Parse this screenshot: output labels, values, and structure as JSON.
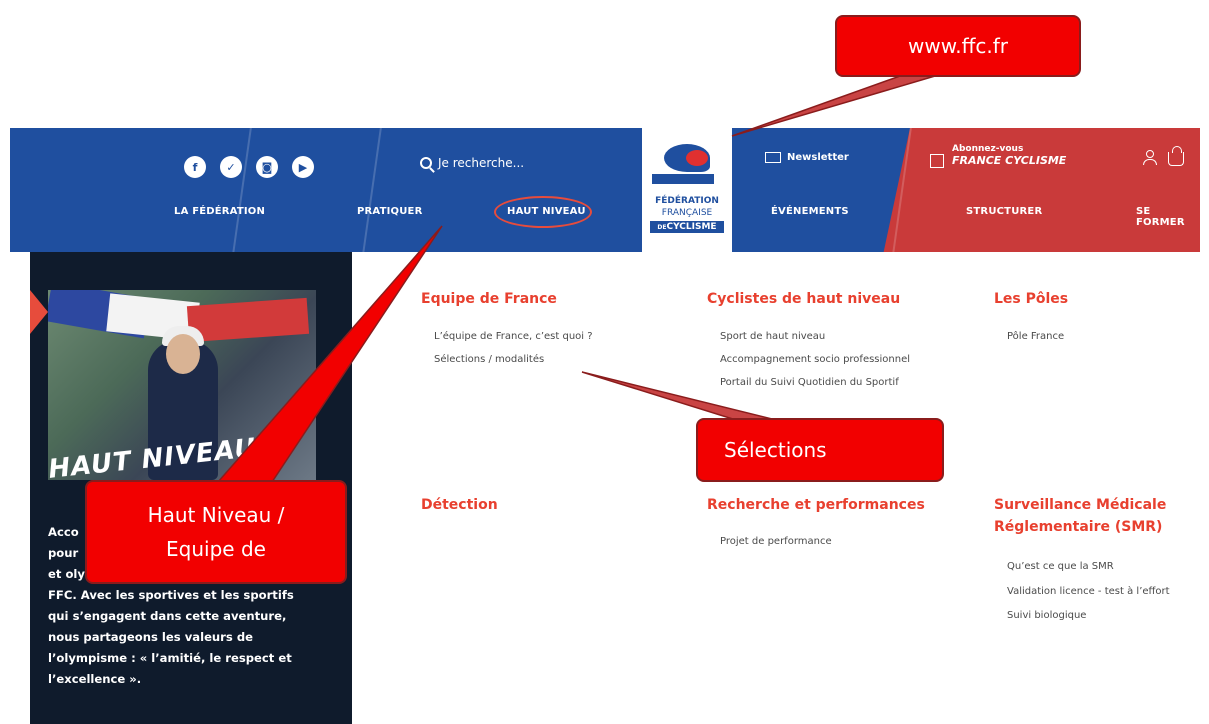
{
  "header": {
    "social": [
      {
        "icon": "facebook-icon",
        "glyph": "f"
      },
      {
        "icon": "twitter-icon",
        "glyph": "✓"
      },
      {
        "icon": "instagram-icon",
        "glyph": "◙"
      },
      {
        "icon": "youtube-icon",
        "glyph": "▶"
      }
    ],
    "search_placeholder": "Je recherche...",
    "nav": [
      "LA FÉDÉRATION",
      "PRATIQUER",
      "HAUT NIVEAU",
      "ÉVÉNEMENTS",
      "STRUCTURER",
      "SE FORMER"
    ],
    "logo": {
      "line1": "FÉDÉRATION",
      "line2": "FRANÇAISE",
      "line3": "CYCLISME",
      "line3_prefix": "DE"
    },
    "newsletter": "Newsletter",
    "abonnez": {
      "line1": "Abonnez-vous",
      "line2": "FRANCE CYCLISME"
    }
  },
  "sidebar": {
    "title": "HAUT NIVEAU",
    "body_visible_start": "Acco",
    "body_line2": "pour",
    "body_line3": "et oly",
    "body_line4": "FFC. Avec les sportives et les sportifs",
    "body_line5": "qui s’engagent dans cette aventure,",
    "body_line6": "nous partageons les valeurs de",
    "body_line7": "l’olympisme : « l’amitié, le respect et",
    "body_line8": "l’excellence »."
  },
  "menu": {
    "col1": {
      "title": "Equipe de France",
      "links": [
        "L’équipe de France, c’est quoi ?",
        "Sélections / modalités"
      ]
    },
    "col2": {
      "title": "Cyclistes de haut niveau",
      "links": [
        "Sport de haut niveau",
        "Accompagnement socio professionnel",
        "Portail du Suivi Quotidien du Sportif"
      ]
    },
    "col3": {
      "title": "Les Pôles",
      "links": [
        "Pôle France"
      ]
    },
    "col4": {
      "title": "Détection",
      "links": []
    },
    "col5": {
      "title": "Recherche et performances",
      "links": [
        "Projet de performance"
      ]
    },
    "col6": {
      "title": "Surveillance Médicale Réglementaire (SMR)",
      "links": [
        "Qu’est ce que la SMR",
        "Validation licence - test à l’effort",
        "Suivi biologique"
      ]
    }
  },
  "callouts": {
    "url": "www.ffc.fr",
    "selections": "Sélections",
    "haut_line1": "Haut Niveau /",
    "haut_line2": "Equipe de"
  },
  "colors": {
    "header_blue": "#1f4f9f",
    "menu_red": "#e8402f",
    "sidebar_dark": "#0f1b2c",
    "callout_red": "#f20000"
  }
}
